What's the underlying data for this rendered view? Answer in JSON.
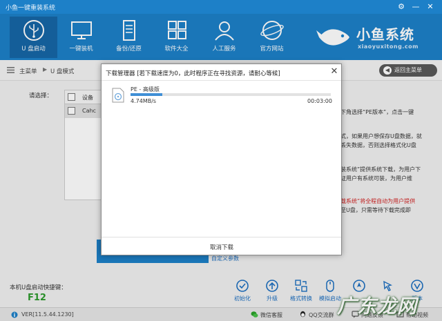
{
  "window": {
    "title": "小鱼一键重装系统",
    "controls": [
      "⚙",
      "—",
      "✕"
    ]
  },
  "nav": [
    {
      "label": "U 盘启动",
      "icon": "usb-icon",
      "active": true
    },
    {
      "label": "一键装机",
      "icon": "monitor-icon",
      "active": false
    },
    {
      "label": "备份/还原",
      "icon": "server-icon",
      "active": false
    },
    {
      "label": "软件大全",
      "icon": "apps-grid-icon",
      "active": false
    },
    {
      "label": "人工服务",
      "icon": "person-icon",
      "active": false
    },
    {
      "label": "官方网站",
      "icon": "globe-icon",
      "active": false
    }
  ],
  "brand": {
    "name": "小鱼系统",
    "domain": "xiaoyuxitong.com"
  },
  "breadcrumb": {
    "home": "主菜单",
    "current": "U 盘模式"
  },
  "back_button": "返回主菜单",
  "background": {
    "choose_label": "请选择：",
    "table_header": "设备",
    "table_row": "Cahc",
    "descriptions": [
      {
        "text": "下角选择“PE版本”，点击一键",
        "red": false
      },
      {
        "text": "式，如果用户想保存U盘数据，就",
        "red": false
      },
      {
        "text": "丢失数据，否则选择格式化U盘",
        "red": false
      },
      {
        "text": "装系统”提供系统下载，为用户下",
        "red": false
      },
      {
        "text": "证用户有系统可装，为用户维",
        "red": false
      },
      {
        "text": "载系统”将全程自动为用户提供",
        "red": true
      },
      {
        "text": "至U盘，只需等待下载完成即",
        "red": false
      }
    ],
    "custom_params": "自定义参数"
  },
  "bottom": {
    "hotkey_label": "本机U盘启动快捷键：",
    "hotkey_value": "F12",
    "tools": [
      {
        "label": "初始化",
        "icon": "check-circle-icon"
      },
      {
        "label": "升级",
        "icon": "upload-icon"
      },
      {
        "label": "格式转换",
        "icon": "convert-icon"
      },
      {
        "label": "模拟启动",
        "icon": "mouse-icon"
      },
      {
        "label": "",
        "icon": "rocket-icon"
      },
      {
        "label": "版本",
        "icon": "version-icon"
      }
    ]
  },
  "status": {
    "version": "VER[11.5.44.1230]",
    "items": [
      {
        "label": "微信客服",
        "icon": "wechat-icon"
      },
      {
        "label": "QQ交流群",
        "icon": "qq-icon"
      },
      {
        "label": "问题反馈",
        "icon": "feedback-icon"
      },
      {
        "label": "帮助视频",
        "icon": "help-video-icon"
      }
    ]
  },
  "watermark": "广东龙网",
  "modal": {
    "title": "下载管理器 [若下载速度为0，此时程序正在寻找资源，请耐心等候]",
    "item": {
      "name": "PE - 高级版",
      "speed": "4.74MB/s",
      "time": "00:03:00",
      "progress": 0.16
    },
    "cancel": "取消下载"
  },
  "colors": {
    "header": "#1d80c8",
    "progress": "#3f8fd6",
    "hotkey": "#2d9a2d"
  }
}
